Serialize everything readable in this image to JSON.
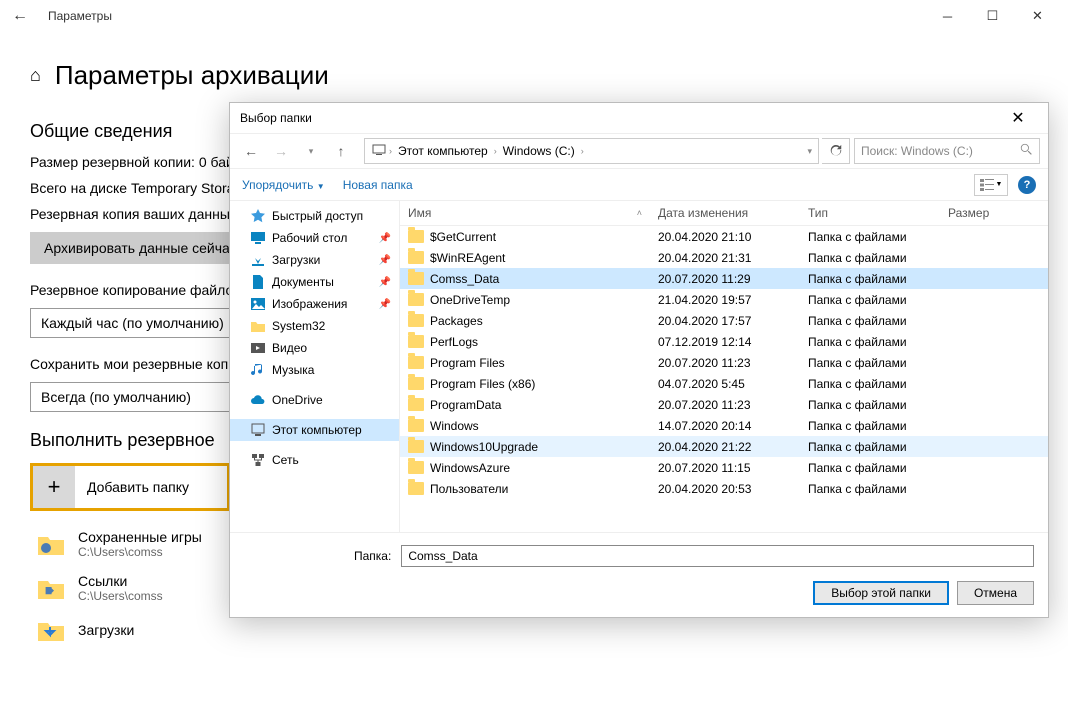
{
  "settings": {
    "window_title": "Параметры",
    "page_title": "Параметры архивации",
    "section_overview": "Общие сведения",
    "backup_size_label": "Размер резервной копии: 0 бай",
    "disk_total_label": "Всего на диске Temporary Stora",
    "backup_your_data": "Резервная копия ваших данных",
    "backup_now_btn": "Архивировать данные сейчас",
    "backup_files_label": "Резервное копирование файло",
    "frequency_value": "Каждый час (по умолчанию)",
    "keep_label": "Сохранить мои резервные коп",
    "keep_value": "Всегда (по умолчанию)",
    "section_backup": "Выполнить резервное",
    "add_folder": "Добавить папку",
    "entries": [
      {
        "name": "Сохраненные игры",
        "path": "C:\\Users\\comss"
      },
      {
        "name": "Ссылки",
        "path": "C:\\Users\\comss"
      },
      {
        "name": "Загрузки",
        "path": ""
      }
    ]
  },
  "dialog": {
    "title": "Выбор папки",
    "breadcrumb": [
      "Этот компьютер",
      "Windows (C:)"
    ],
    "search_placeholder": "Поиск: Windows (C:)",
    "toolbar": {
      "organize": "Упорядочить",
      "newfolder": "Новая папка"
    },
    "tree": [
      {
        "label": "Быстрый доступ",
        "icon": "star",
        "color": "#3b9bde"
      },
      {
        "label": "Рабочий стол",
        "icon": "desktop",
        "color": "#0a84c1",
        "pin": true
      },
      {
        "label": "Загрузки",
        "icon": "download",
        "color": "#0a84c1",
        "pin": true
      },
      {
        "label": "Документы",
        "icon": "doc",
        "color": "#0a84c1",
        "pin": true
      },
      {
        "label": "Изображения",
        "icon": "image",
        "color": "#0a84c1",
        "pin": true
      },
      {
        "label": "System32",
        "icon": "folder",
        "color": "#ffd86b"
      },
      {
        "label": "Видео",
        "icon": "video",
        "color": "#555"
      },
      {
        "label": "Музыка",
        "icon": "music",
        "color": "#1e7bc8"
      },
      {
        "spacer": true
      },
      {
        "label": "OneDrive",
        "icon": "cloud",
        "color": "#0a84c1"
      },
      {
        "spacer": true
      },
      {
        "label": "Этот компьютер",
        "icon": "pc",
        "color": "#555",
        "selected": true
      },
      {
        "spacer": true
      },
      {
        "label": "Сеть",
        "icon": "net",
        "color": "#555"
      }
    ],
    "columns": {
      "name": "Имя",
      "date": "Дата изменения",
      "type": "Тип",
      "size": "Размер"
    },
    "rows": [
      {
        "name": "$GetCurrent",
        "date": "20.04.2020 21:10",
        "type": "Папка с файлами"
      },
      {
        "name": "$WinREAgent",
        "date": "20.04.2020 21:31",
        "type": "Папка с файлами"
      },
      {
        "name": "Comss_Data",
        "date": "20.07.2020 11:29",
        "type": "Папка с файлами",
        "selected": true
      },
      {
        "name": "OneDriveTemp",
        "date": "21.04.2020 19:57",
        "type": "Папка с файлами"
      },
      {
        "name": "Packages",
        "date": "20.04.2020 17:57",
        "type": "Папка с файлами"
      },
      {
        "name": "PerfLogs",
        "date": "07.12.2019 12:14",
        "type": "Папка с файлами"
      },
      {
        "name": "Program Files",
        "date": "20.07.2020 11:23",
        "type": "Папка с файлами"
      },
      {
        "name": "Program Files (x86)",
        "date": "04.07.2020 5:45",
        "type": "Папка с файлами"
      },
      {
        "name": "ProgramData",
        "date": "20.07.2020 11:23",
        "type": "Папка с файлами"
      },
      {
        "name": "Windows",
        "date": "14.07.2020 20:14",
        "type": "Папка с файлами"
      },
      {
        "name": "Windows10Upgrade",
        "date": "20.04.2020 21:22",
        "type": "Папка с файлами",
        "highlight": true
      },
      {
        "name": "WindowsAzure",
        "date": "20.07.2020 11:15",
        "type": "Папка с файлами"
      },
      {
        "name": "Пользователи",
        "date": "20.04.2020 20:53",
        "type": "Папка с файлами"
      }
    ],
    "folder_label": "Папка:",
    "folder_value": "Comss_Data",
    "btn_select": "Выбор этой папки",
    "btn_cancel": "Отмена"
  }
}
